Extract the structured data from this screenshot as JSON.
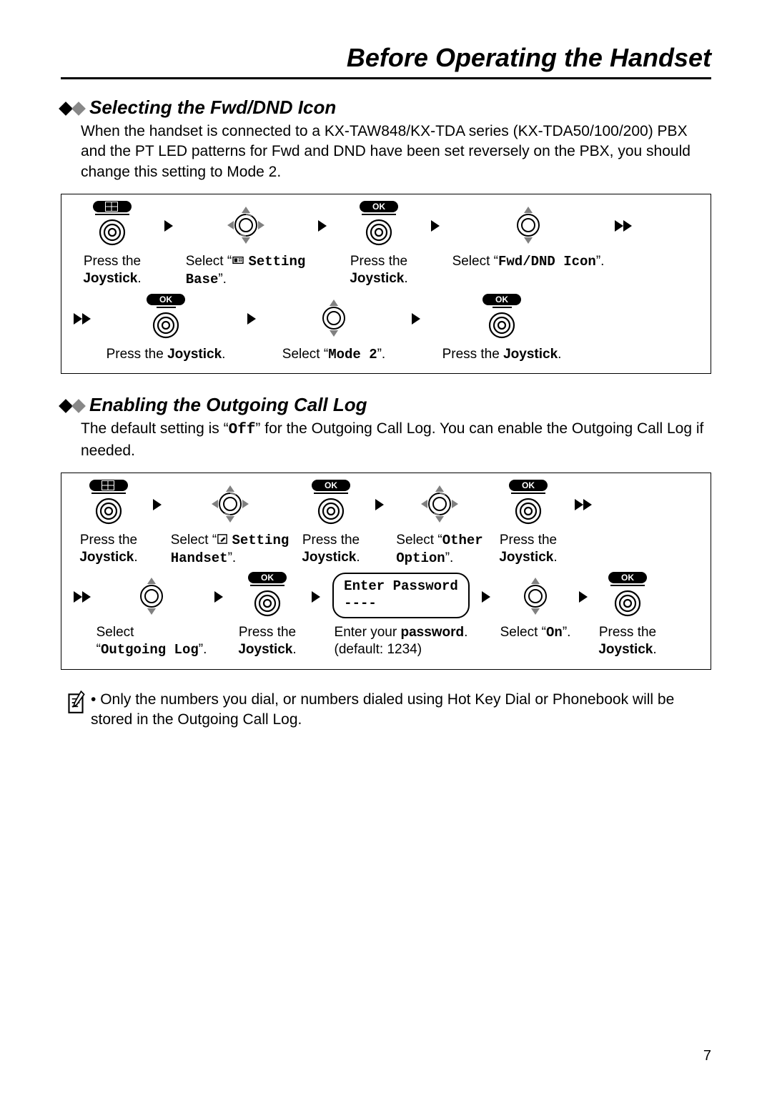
{
  "page": {
    "title": "Before Operating the Handset",
    "number": "7"
  },
  "sec1": {
    "title": "Selecting the Fwd/DND Icon",
    "body_parts": [
      "When the handset is connected to a KX-TAW848/KX-TDA series (KX-TDA50/100/200) PBX and the PT LED patterns for Fwd and DND have been set reversely on the PBX, you should change this setting to Mode 2."
    ],
    "steps": {
      "s1": {
        "l1": "Press the",
        "l2": "Joystick"
      },
      "s2": {
        "l1": "Select “",
        "m1": "Setting",
        "m2": "Base",
        "q2": "”."
      },
      "s3": {
        "l1": "Press the",
        "l2": "Joystick"
      },
      "s4": {
        "l1": "Select “",
        "m1": "Fwd/DND Icon",
        "q2": "”."
      },
      "s5": {
        "l1": "Press the ",
        "l2": "Joystick"
      },
      "s6": {
        "l1": "Select “",
        "m1": "Mode 2",
        "q2": "”."
      },
      "s7": {
        "l1": "Press the ",
        "l2": "Joystick"
      }
    }
  },
  "sec2": {
    "title": "Enabling the Outgoing Call Log",
    "body_a": "The default setting is “",
    "body_b": "Off",
    "body_c": "” for the Outgoing Call Log. You can enable the Outgoing Call Log if needed.",
    "steps": {
      "s1": {
        "l1": "Press the",
        "l2": "Joystick"
      },
      "s2": {
        "l1": "Select “",
        "m1": "Setting",
        "m2": "Handset",
        "q2": "”."
      },
      "s3": {
        "l1": "Press the",
        "l2": "Joystick"
      },
      "s4": {
        "l1": "Select “",
        "m1": "Other",
        "m2": "Option",
        "q2": "”."
      },
      "s5": {
        "l1": "Press the",
        "l2": "Joystick"
      },
      "s6": {
        "l1": "Select",
        "q1": "“",
        "m1": "Outgoing Log",
        "q2": "”."
      },
      "s7": {
        "l1": "Press the",
        "l2": "Joystick"
      },
      "s8": {
        "box1": "Enter Password",
        "box2": "----",
        "l1": "Enter your ",
        "l2": "password",
        "l3": "(default: 1234)"
      },
      "s9": {
        "l1": "Select “",
        "m1": "On",
        "q2": "”."
      },
      "s10": {
        "l1": "Press the",
        "l2": "Joystick"
      }
    },
    "note": "Only the numbers you dial, or numbers dialed using Hot Key Dial or Phonebook will be stored in the Outgoing Call Log."
  },
  "ui": {
    "ok": "OK",
    "dot": "."
  }
}
